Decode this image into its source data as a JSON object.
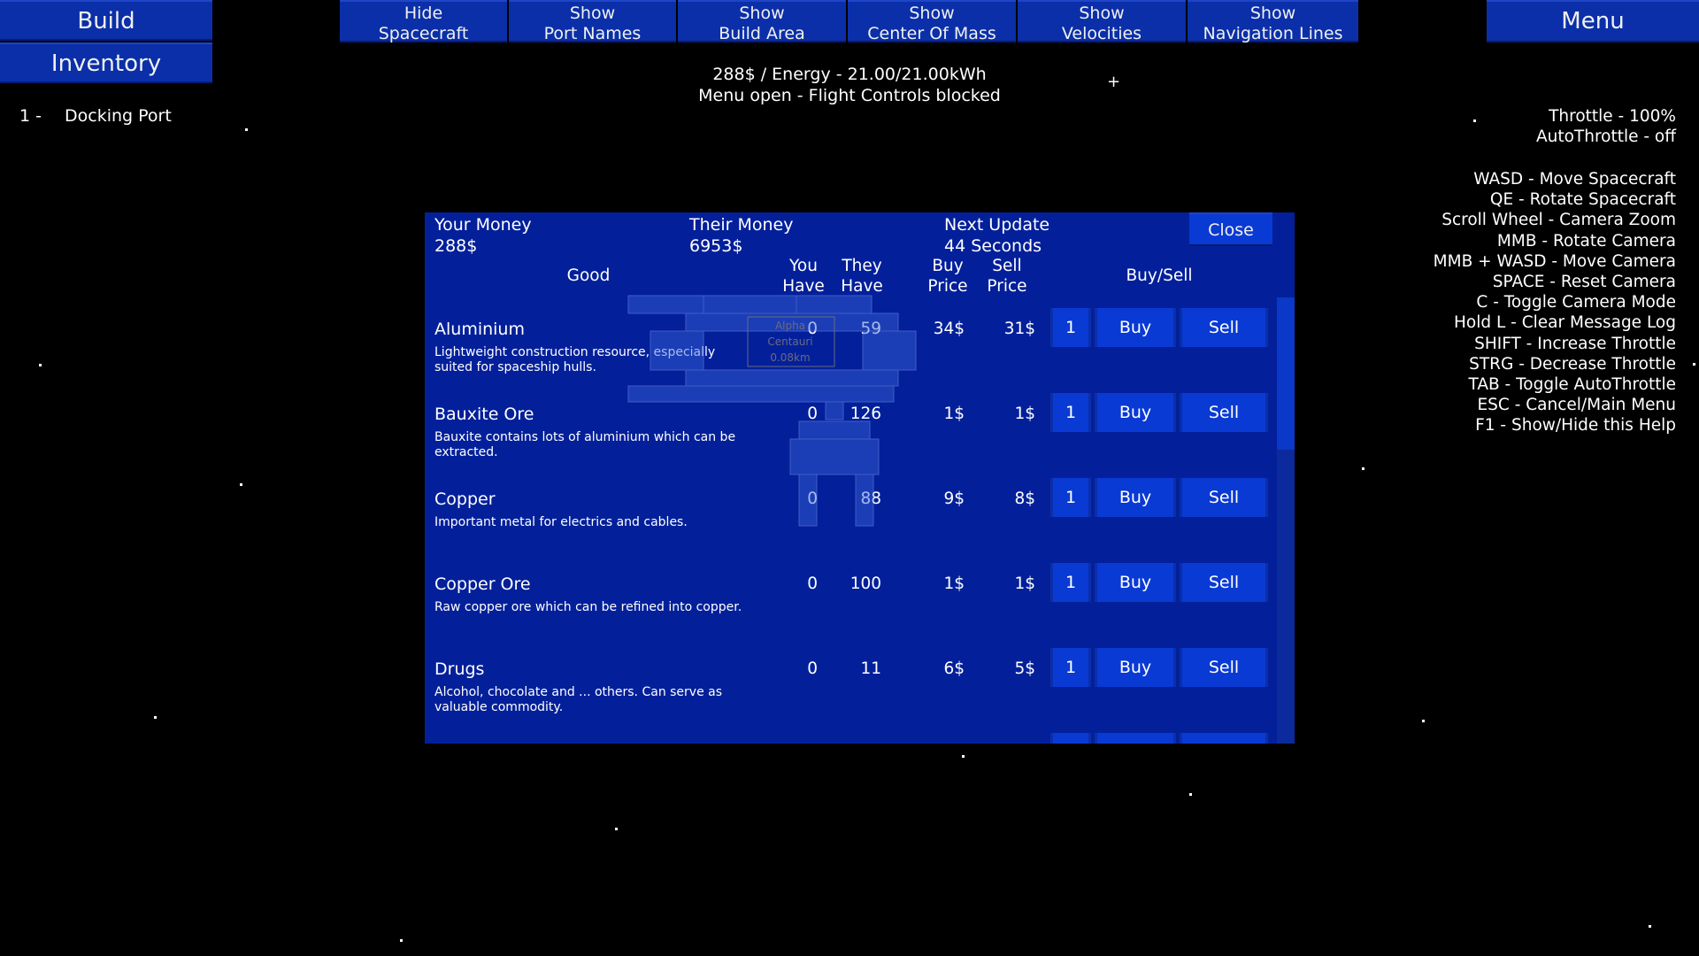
{
  "top_left": {
    "build_label": "Build",
    "inventory_label": "Inventory"
  },
  "toolbar": {
    "buttons": [
      {
        "line1": "Hide",
        "line2": "Spacecraft"
      },
      {
        "line1": "Show",
        "line2": "Port Names"
      },
      {
        "line1": "Show",
        "line2": "Build Area"
      },
      {
        "line1": "Show",
        "line2": "Center Of Mass"
      },
      {
        "line1": "Show",
        "line2": "Velocities"
      },
      {
        "line1": "Show",
        "line2": "Navigation Lines"
      }
    ],
    "menu_label": "Menu"
  },
  "status": {
    "money_energy": "288$ / Energy - 21.00/21.00kWh",
    "menu_state": "Menu open - Flight Controls blocked"
  },
  "inventory": {
    "index": "1 -",
    "item": "Docking Port"
  },
  "throttle": {
    "throttle": "Throttle - 100%",
    "autothrottle": "AutoThrottle - off"
  },
  "help_lines": [
    "WASD - Move Spacecraft",
    "QE - Rotate Spacecraft",
    "Scroll Wheel - Camera Zoom",
    "MMB - Rotate Camera",
    "MMB + WASD - Move Camera",
    "SPACE - Reset Camera",
    "C - Toggle Camera Mode",
    "Hold L - Clear Message Log",
    "SHIFT - Increase Throttle",
    "STRG - Decrease Throttle",
    "TAB - Toggle AutoThrottle",
    "ESC - Cancel/Main Menu",
    "F1 - Show/Hide this Help"
  ],
  "trade": {
    "your_money_label": "Your Money",
    "your_money": "288$",
    "their_money_label": "Their Money",
    "their_money": "6953$",
    "next_update_label": "Next Update",
    "next_update": "44 Seconds",
    "close_label": "Close",
    "columns": {
      "good": "Good",
      "you_have_1": "You",
      "you_have_2": "Have",
      "they_have_1": "They",
      "they_have_2": "Have",
      "buy_price_1": "Buy",
      "buy_price_2": "Price",
      "sell_price_1": "Sell",
      "sell_price_2": "Price",
      "buy_sell": "Buy/Sell"
    },
    "goods": [
      {
        "name": "Aluminium",
        "desc": "Lightweight construction resource, especially suited for spaceship hulls.",
        "you_have": "0",
        "they_have": "59",
        "buy_price": "34$",
        "sell_price": "31$",
        "qty": "1",
        "buy": "Buy",
        "sell": "Sell"
      },
      {
        "name": "Bauxite Ore",
        "desc": "Bauxite contains lots of aluminium which can be extracted.",
        "you_have": "0",
        "they_have": "126",
        "buy_price": "1$",
        "sell_price": "1$",
        "qty": "1",
        "buy": "Buy",
        "sell": "Sell"
      },
      {
        "name": "Copper",
        "desc": "Important metal for electrics and cables.",
        "you_have": "0",
        "they_have": "88",
        "buy_price": "9$",
        "sell_price": "8$",
        "qty": "1",
        "buy": "Buy",
        "sell": "Sell"
      },
      {
        "name": "Copper Ore",
        "desc": "Raw copper ore which can be refined into copper.",
        "you_have": "0",
        "they_have": "100",
        "buy_price": "1$",
        "sell_price": "1$",
        "qty": "1",
        "buy": "Buy",
        "sell": "Sell"
      },
      {
        "name": "Drugs",
        "desc": "Alcohol, chocolate and ... others. Can serve as valuable commodity.",
        "you_have": "0",
        "they_have": "11",
        "buy_price": "6$",
        "sell_price": "5$",
        "qty": "1",
        "buy": "Buy",
        "sell": "Sell"
      }
    ]
  },
  "ship_label": {
    "line1": "Alpha",
    "line2": "Centauri",
    "line3": "0.08km"
  },
  "colors": {
    "panel": "#03209a",
    "button": "#0a2fa8",
    "button_active": "#0a3ad4",
    "background": "#000000"
  }
}
